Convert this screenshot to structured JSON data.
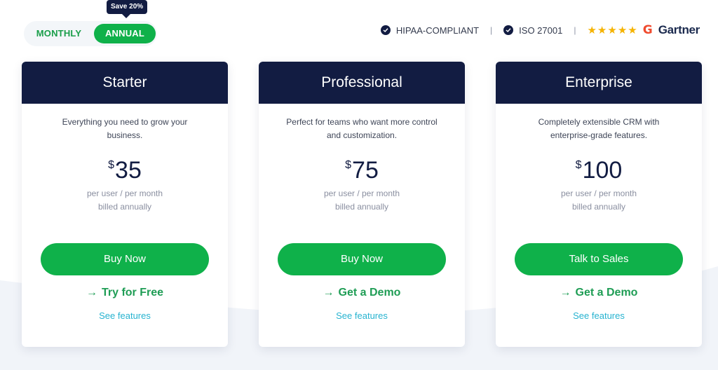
{
  "billing_toggle": {
    "options": [
      "MONTHLY",
      "ANNUAL"
    ],
    "selected": "ANNUAL",
    "tooltip": "Save 20%"
  },
  "trust_bar": {
    "badges": [
      "HIPAA-COMPLIANT",
      "ISO 27001"
    ],
    "separator": "|",
    "rating_stars": 5,
    "review_brand": "G",
    "analyst_brand": "Gartner"
  },
  "colors": {
    "navy": "#121c42",
    "green": "#0fb14a",
    "link_green": "#1f9d55",
    "link_blue": "#27b3d0",
    "star": "#f5b301",
    "g2_red": "#ef4b2f"
  },
  "plans": [
    {
      "name": "Starter",
      "description": "Everything you need to grow your business.",
      "currency": "$",
      "price": "35",
      "unit": "per user / per month",
      "billing": "billed annually",
      "cta": "Buy Now",
      "secondary_arrow": "→",
      "secondary": "Try for Free",
      "features": "See features"
    },
    {
      "name": "Professional",
      "description": "Perfect for teams who want more control and customization.",
      "currency": "$",
      "price": "75",
      "unit": "per user / per month",
      "billing": "billed annually",
      "cta": "Buy Now",
      "secondary_arrow": "→",
      "secondary": "Get a Demo",
      "features": "See features"
    },
    {
      "name": "Enterprise",
      "description": "Completely extensible CRM with enterprise-grade features.",
      "currency": "$",
      "price": "100",
      "unit": "per user / per month",
      "billing": "billed annually",
      "cta": "Talk to Sales",
      "secondary_arrow": "→",
      "secondary": "Get a Demo",
      "features": "See features"
    }
  ]
}
